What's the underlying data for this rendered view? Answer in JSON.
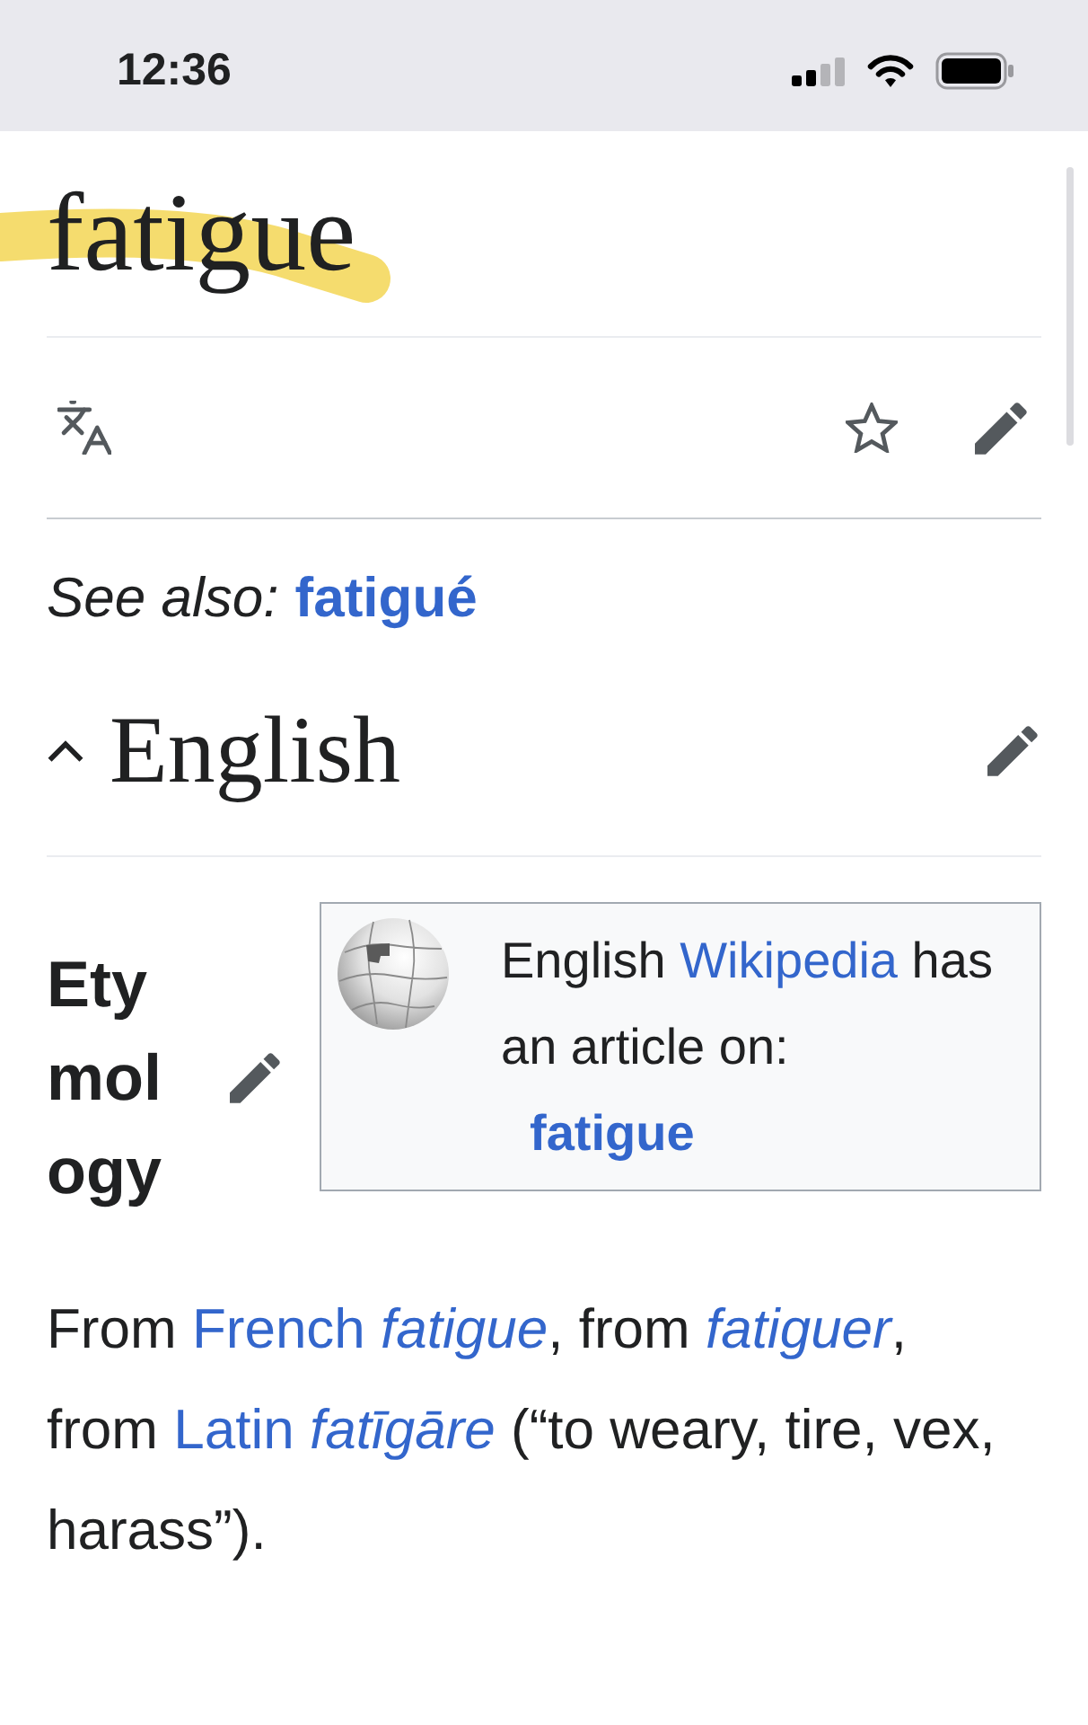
{
  "status_bar": {
    "time": "12:36"
  },
  "header": {
    "title": "fatigue",
    "highlighted": true
  },
  "see_also": {
    "label": "See also:",
    "link": "fatigué"
  },
  "section": {
    "heading": "English",
    "expanded": true
  },
  "etymology": {
    "heading": "Etymology"
  },
  "wikipedia_box": {
    "text_before": "English",
    "link": "Wikipedia",
    "text_after": "has an article on:",
    "article": "fatigue"
  },
  "etymology_text": [
    {
      "kind": "plain",
      "text": "From "
    },
    {
      "kind": "link",
      "text": "French"
    },
    {
      "kind": "term",
      "text": "fatigue"
    },
    {
      "kind": "plain",
      "text": ", from "
    },
    {
      "kind": "term",
      "text": "fatiguer"
    },
    {
      "kind": "plain",
      "text": ", from "
    },
    {
      "kind": "link",
      "text": "Latin"
    },
    {
      "kind": "term",
      "text": "fatīgāre"
    },
    {
      "kind": "plain",
      "text": " (“to weary, tire, vex, harass”)."
    }
  ]
}
